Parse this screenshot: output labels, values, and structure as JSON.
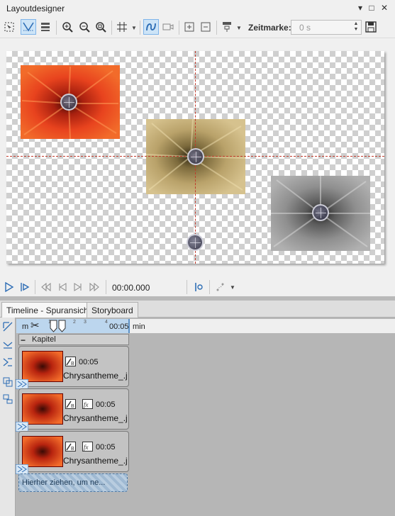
{
  "window": {
    "title": "Layoutdesigner"
  },
  "toolbar": {
    "zeitmarke_label": "Zeitmarke:",
    "zeitmarke_value": "0 s"
  },
  "playback": {
    "time": "00:00.000"
  },
  "timeline": {
    "tabs": [
      "Timeline - Spuransicht",
      "Storyboard"
    ],
    "ruler": {
      "left_label": "m",
      "right_label": "00:05",
      "unit": "min",
      "tick_labels": [
        "1",
        "2",
        "3",
        "4"
      ]
    },
    "chapter_label": "Kapitel",
    "tracks": [
      {
        "duration": "00:05",
        "name": "Chrysantheme_.j"
      },
      {
        "duration": "00:05",
        "name": "Chrysantheme_.j"
      },
      {
        "duration": "00:05",
        "name": "Chrysantheme_.j"
      }
    ],
    "drop_zone": "Hierher ziehen, um ne..."
  },
  "colors": {
    "accent": "#3a8ee6",
    "guide": "#c0392b",
    "flower_red": "#d9381e"
  }
}
